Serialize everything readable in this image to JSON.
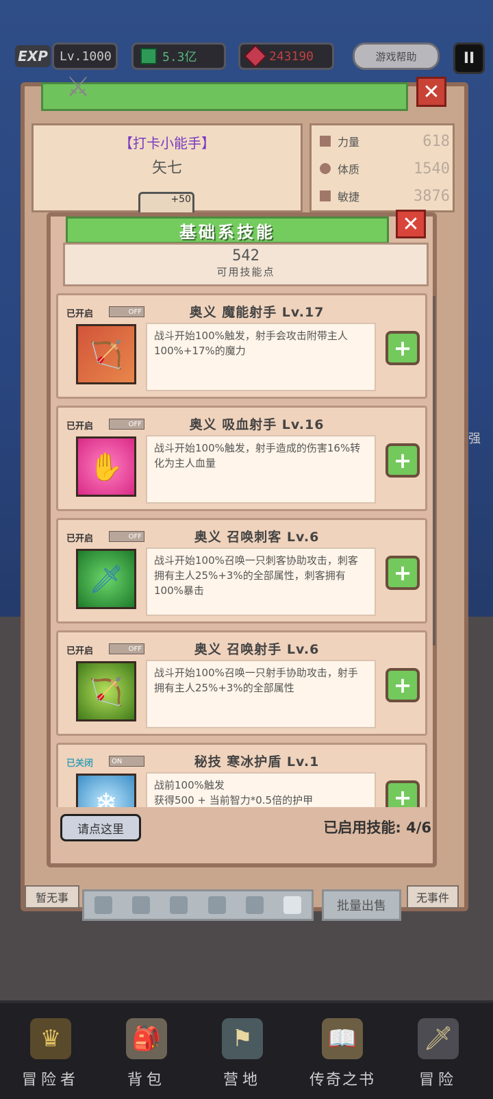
{
  "hud": {
    "exp_tag": "EXP",
    "level": "Lv.1000",
    "currency_green": "5.3亿",
    "currency_red": "243190",
    "help_label": "游戏帮助",
    "pause_glyph": "II"
  },
  "character": {
    "title": "【打卡小能手】",
    "name": "矢七",
    "badge_plus": "+50",
    "stats": [
      {
        "label": "力量",
        "value": "618"
      },
      {
        "label": "体质",
        "value": "1540"
      },
      {
        "label": "敏捷",
        "value": "3876"
      }
    ]
  },
  "background": {
    "side_left_1": "暂无事",
    "side_right_1": "无事件",
    "batch_sell": "批量出售",
    "right_edge_text": "强"
  },
  "skill_modal": {
    "title": "基础系技能",
    "points_value": "542",
    "points_label": "可用技能点",
    "skills": [
      {
        "status": "已开启",
        "toggle": "OFF",
        "name": "奥义 魔能射手 Lv.17",
        "desc": "战斗开始100%触发，射手会攻击附带主人100%+17%的魔力",
        "icon": "bow-icon"
      },
      {
        "status": "已开启",
        "toggle": "OFF",
        "name": "奥义 吸血射手 Lv.16",
        "desc": "战斗开始100%触发，射手造成的伤害16%转化为主人血量",
        "icon": "vampire-icon"
      },
      {
        "status": "已开启",
        "toggle": "OFF",
        "name": "奥义 召唤刺客 Lv.6",
        "desc": "战斗开始100%召唤一只刺客协助攻击，刺客拥有主人25%+3%的全部属性，刺客拥有100%暴击",
        "icon": "assassin-icon"
      },
      {
        "status": "已开启",
        "toggle": "OFF",
        "name": "奥义 召唤射手 Lv.6",
        "desc": "战斗开始100%召唤一只射手协助攻击，射手拥有主人25%+3%的全部属性",
        "icon": "archer-icon"
      },
      {
        "status": "已关闭",
        "toggle": "ON",
        "name": "秘技 寒冰护盾 Lv.1",
        "desc": "战前100%触发\n获得500 + 当前智力*0.5倍的护甲",
        "icon": "ice-shield-icon"
      }
    ],
    "click_here": "请点这里",
    "enabled_label": "已启用技能: 4/6"
  },
  "bottom_nav": [
    {
      "label": "冒险者"
    },
    {
      "label": "背包"
    },
    {
      "label": "营地"
    },
    {
      "label": "传奇之书"
    },
    {
      "label": "冒险"
    }
  ],
  "colors": {
    "accent_green": "#74cc5f",
    "close_red": "#d9453a",
    "panel_tan": "#dcb9a2",
    "title_purple": "#7b3bc0"
  }
}
